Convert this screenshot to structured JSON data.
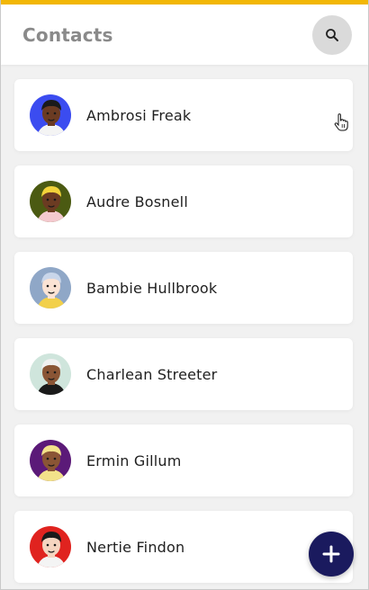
{
  "header": {
    "title": "Contacts",
    "accent_color": "#f2b705",
    "search_icon": "search-icon"
  },
  "contacts": [
    {
      "name": "Ambrosi Freak",
      "avatar_bg": "#3b4cf0",
      "skin": "#6b3b22",
      "hair": "#1a1a1a",
      "shirt": "#f4f4f4"
    },
    {
      "name": "Audre Bosnell",
      "avatar_bg": "#4b5a12",
      "skin": "#6b3b22",
      "hair": "#f2d23a",
      "shirt": "#f4c9cf"
    },
    {
      "name": "Bambie Hullbrook",
      "avatar_bg": "#8fa7c7",
      "skin": "#fbe3d4",
      "hair": "#c9d6ea",
      "shirt": "#f2d04a"
    },
    {
      "name": "Charlean Streeter",
      "avatar_bg": "#cfe5dc",
      "skin": "#8a5535",
      "hair": "#f0f0f0",
      "shirt": "#1a1a1a"
    },
    {
      "name": "Ermin Gillum",
      "avatar_bg": "#5b1a78",
      "skin": "#8a5535",
      "hair": "#f2e28a",
      "shirt": "#f2e28a"
    },
    {
      "name": "Nertie Findon",
      "avatar_bg": "#e0231f",
      "skin": "#f5d5c0",
      "hair": "#1a1a1a",
      "shirt": "#f4f4f4"
    }
  ],
  "fab": {
    "icon": "plus-icon",
    "color": "#1a1a5e"
  }
}
